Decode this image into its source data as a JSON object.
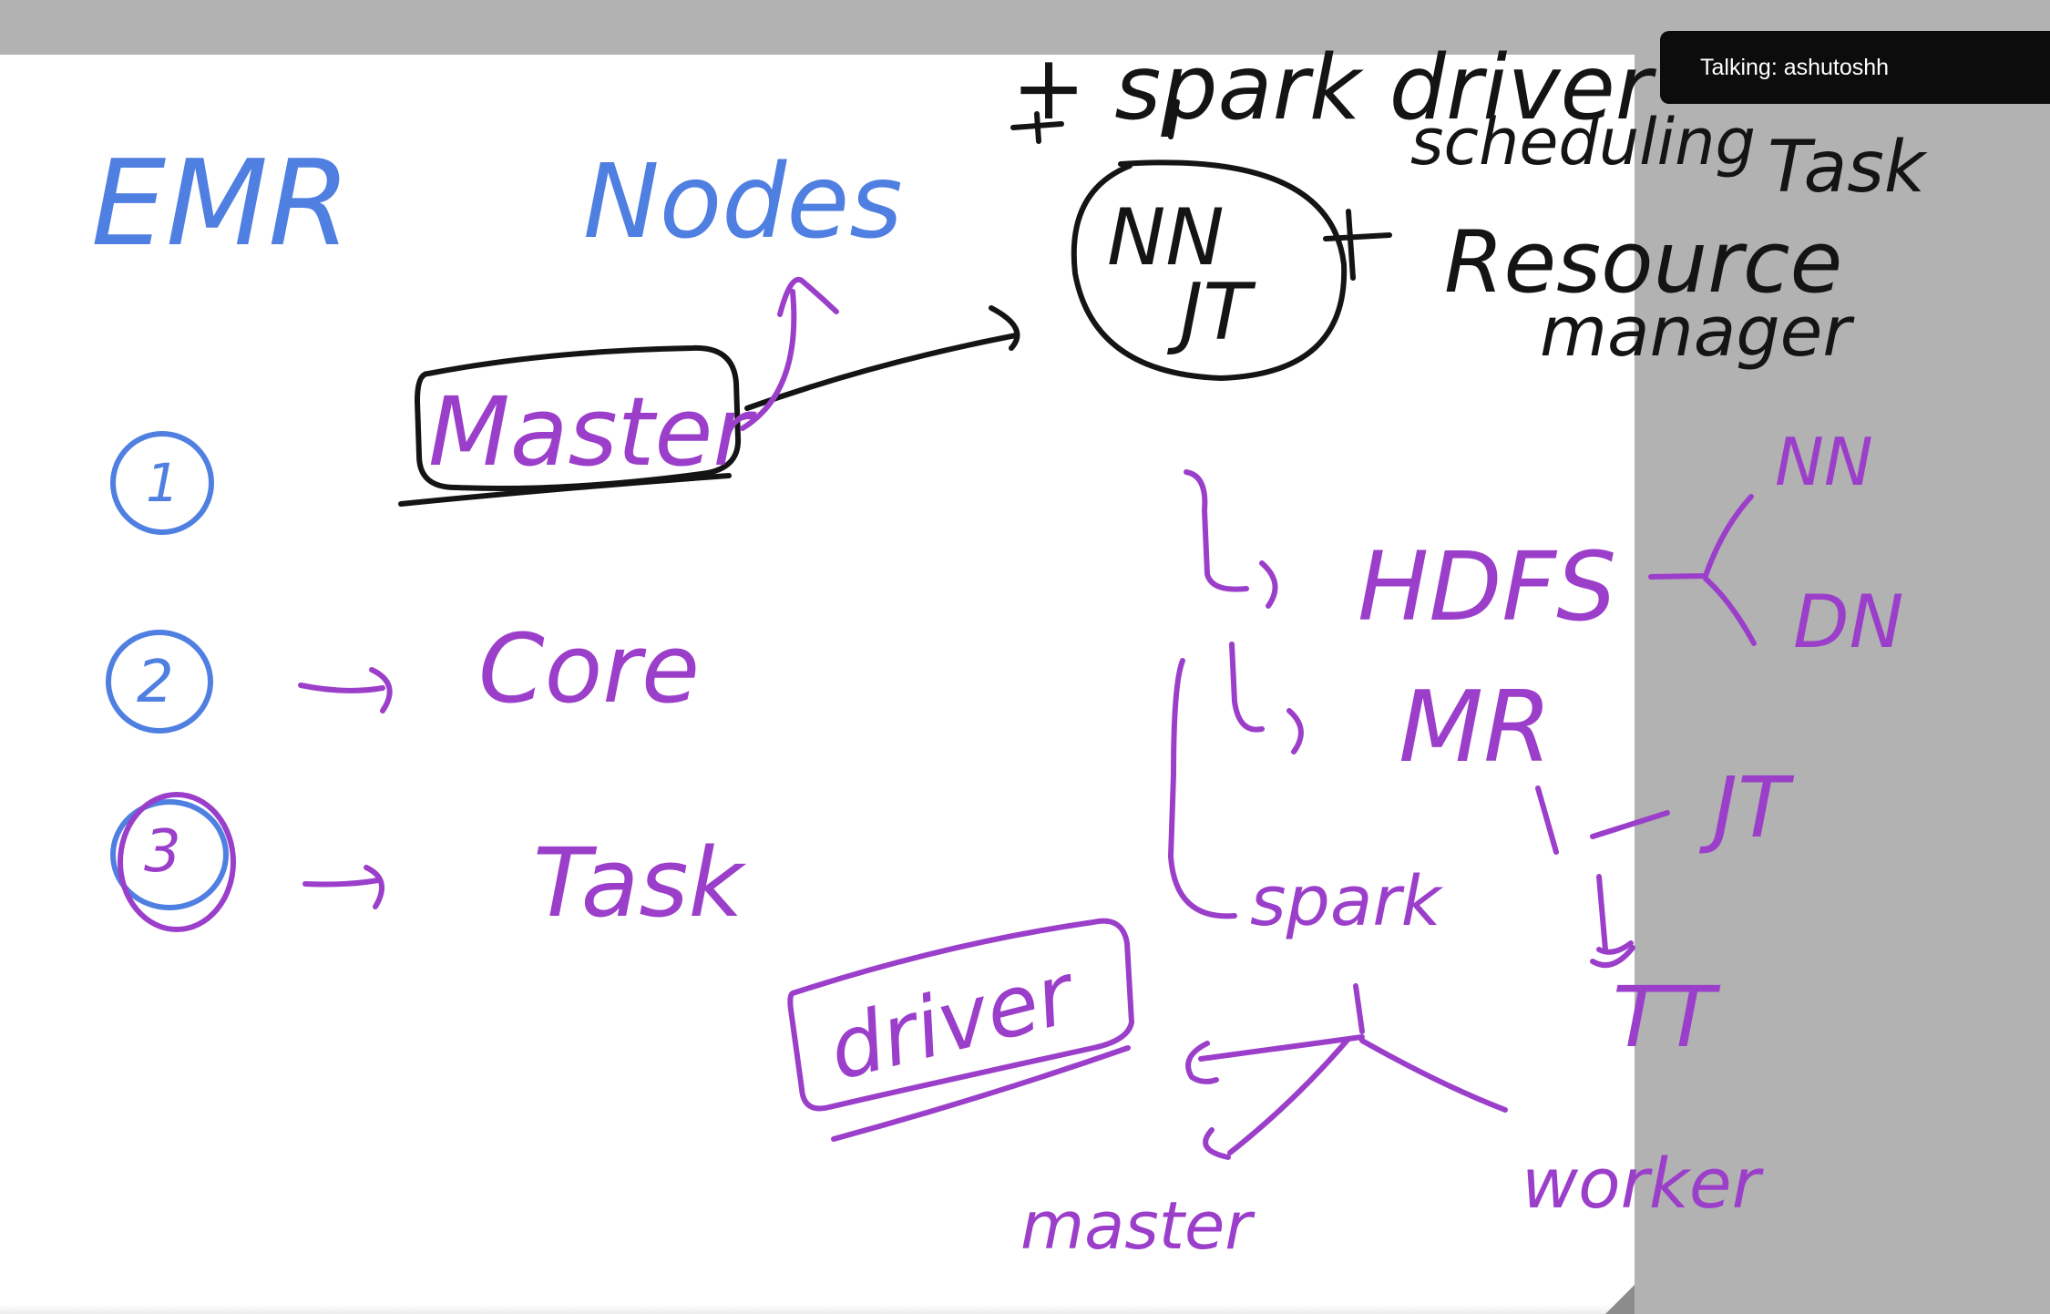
{
  "banner": {
    "prefix": "Talking:",
    "speaker": "ashutoshh"
  },
  "colors": {
    "blue_ink": "#4f7fe0",
    "purple_ink": "#9b3fcb",
    "black_ink": "#141414",
    "canvas": "#ffffff",
    "background": "#b2b2b2",
    "banner_bg": "#0c0c0c"
  },
  "board": {
    "title": "EMR",
    "nodes_heading": "Nodes",
    "list": [
      {
        "number": "1",
        "label": "Master"
      },
      {
        "number": "2",
        "label": "Core"
      },
      {
        "number": "3",
        "label": "Task"
      }
    ],
    "master_annotation": {
      "circle_top": "NN",
      "circle_bottom": "JT",
      "plus_left": "+ spark driver",
      "right_line1": "scheduling",
      "right_line2": "Task",
      "right_line3": "Resource",
      "right_line4": "manager"
    },
    "tree": {
      "hdfs": "HDFS",
      "hdfs_children": [
        "NN",
        "DN"
      ],
      "mr": "MR",
      "mr_children": [
        "JT",
        "TT"
      ],
      "spark": "spark",
      "spark_children": [
        "master",
        "worker"
      ],
      "driver": "driver"
    }
  }
}
